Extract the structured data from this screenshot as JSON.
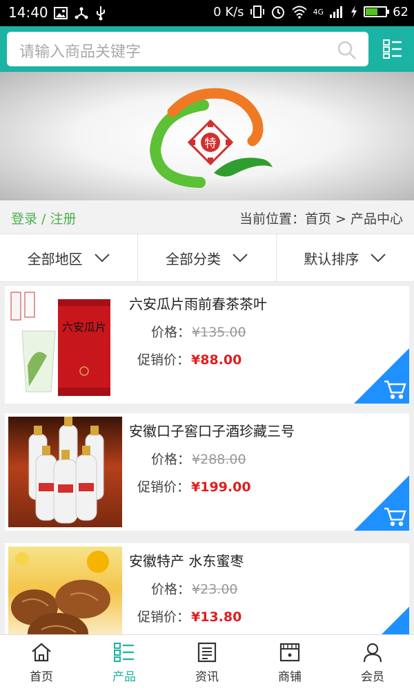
{
  "status": {
    "time": "14:40",
    "speed": "0 K/s",
    "network": "4G",
    "battery": "62",
    "battery_percent": 62
  },
  "search": {
    "placeholder": "请输入商品关键字"
  },
  "logo": {
    "text": "特"
  },
  "breadcrumb_bar": {
    "login": "登录 / 注册",
    "location": "当前位置：首页 > 产品中心"
  },
  "filters": [
    {
      "label": "全部地区"
    },
    {
      "label": "全部分类"
    },
    {
      "label": "默认排序"
    }
  ],
  "products": [
    {
      "name": "六安瓜片雨前春茶茶叶",
      "price_label": "价格：",
      "price": "¥135.00",
      "promo_label": "促销价：",
      "promo_price": "¥88.00",
      "can_text": "六安瓜片"
    },
    {
      "name": "安徽口子窖口子酒珍藏三号",
      "price_label": "价格：",
      "price": "¥288.00",
      "promo_label": "促销价：",
      "promo_price": "¥199.00"
    },
    {
      "name": "安徽特产 水东蜜枣",
      "price_label": "价格：",
      "price": "¥23.00",
      "promo_label": "促销价：",
      "promo_price": "¥13.80"
    }
  ],
  "nav": [
    {
      "label": "首页",
      "icon": "home-icon"
    },
    {
      "label": "产品",
      "icon": "product-list-icon"
    },
    {
      "label": "资讯",
      "icon": "news-icon"
    },
    {
      "label": "商铺",
      "icon": "shop-icon"
    },
    {
      "label": "会员",
      "icon": "member-icon"
    }
  ],
  "colors": {
    "accent": "#1bb3a3",
    "login_green": "#4caf50",
    "price_red": "#e11d1d",
    "cart_blue": "#1e90ff"
  }
}
